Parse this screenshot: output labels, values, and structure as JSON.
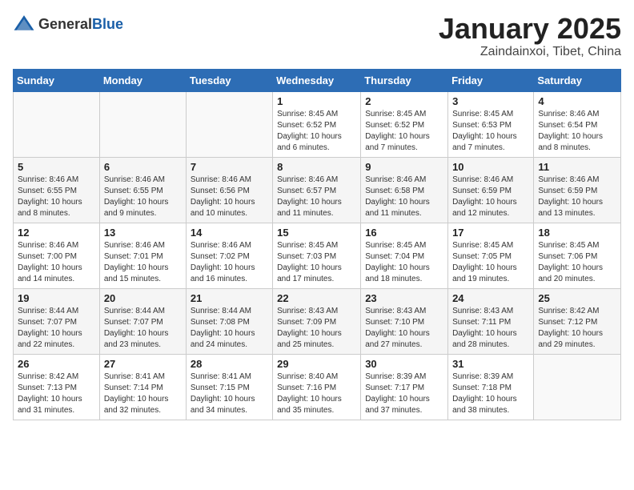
{
  "header": {
    "logo_general": "General",
    "logo_blue": "Blue",
    "month_title": "January 2025",
    "location": "Zaindainxoi, Tibet, China"
  },
  "weekdays": [
    "Sunday",
    "Monday",
    "Tuesday",
    "Wednesday",
    "Thursday",
    "Friday",
    "Saturday"
  ],
  "weeks": [
    [
      {
        "day": "",
        "info": ""
      },
      {
        "day": "",
        "info": ""
      },
      {
        "day": "",
        "info": ""
      },
      {
        "day": "1",
        "info": "Sunrise: 8:45 AM\nSunset: 6:52 PM\nDaylight: 10 hours\nand 6 minutes."
      },
      {
        "day": "2",
        "info": "Sunrise: 8:45 AM\nSunset: 6:52 PM\nDaylight: 10 hours\nand 7 minutes."
      },
      {
        "day": "3",
        "info": "Sunrise: 8:45 AM\nSunset: 6:53 PM\nDaylight: 10 hours\nand 7 minutes."
      },
      {
        "day": "4",
        "info": "Sunrise: 8:46 AM\nSunset: 6:54 PM\nDaylight: 10 hours\nand 8 minutes."
      }
    ],
    [
      {
        "day": "5",
        "info": "Sunrise: 8:46 AM\nSunset: 6:55 PM\nDaylight: 10 hours\nand 8 minutes."
      },
      {
        "day": "6",
        "info": "Sunrise: 8:46 AM\nSunset: 6:55 PM\nDaylight: 10 hours\nand 9 minutes."
      },
      {
        "day": "7",
        "info": "Sunrise: 8:46 AM\nSunset: 6:56 PM\nDaylight: 10 hours\nand 10 minutes."
      },
      {
        "day": "8",
        "info": "Sunrise: 8:46 AM\nSunset: 6:57 PM\nDaylight: 10 hours\nand 11 minutes."
      },
      {
        "day": "9",
        "info": "Sunrise: 8:46 AM\nSunset: 6:58 PM\nDaylight: 10 hours\nand 11 minutes."
      },
      {
        "day": "10",
        "info": "Sunrise: 8:46 AM\nSunset: 6:59 PM\nDaylight: 10 hours\nand 12 minutes."
      },
      {
        "day": "11",
        "info": "Sunrise: 8:46 AM\nSunset: 6:59 PM\nDaylight: 10 hours\nand 13 minutes."
      }
    ],
    [
      {
        "day": "12",
        "info": "Sunrise: 8:46 AM\nSunset: 7:00 PM\nDaylight: 10 hours\nand 14 minutes."
      },
      {
        "day": "13",
        "info": "Sunrise: 8:46 AM\nSunset: 7:01 PM\nDaylight: 10 hours\nand 15 minutes."
      },
      {
        "day": "14",
        "info": "Sunrise: 8:46 AM\nSunset: 7:02 PM\nDaylight: 10 hours\nand 16 minutes."
      },
      {
        "day": "15",
        "info": "Sunrise: 8:45 AM\nSunset: 7:03 PM\nDaylight: 10 hours\nand 17 minutes."
      },
      {
        "day": "16",
        "info": "Sunrise: 8:45 AM\nSunset: 7:04 PM\nDaylight: 10 hours\nand 18 minutes."
      },
      {
        "day": "17",
        "info": "Sunrise: 8:45 AM\nSunset: 7:05 PM\nDaylight: 10 hours\nand 19 minutes."
      },
      {
        "day": "18",
        "info": "Sunrise: 8:45 AM\nSunset: 7:06 PM\nDaylight: 10 hours\nand 20 minutes."
      }
    ],
    [
      {
        "day": "19",
        "info": "Sunrise: 8:44 AM\nSunset: 7:07 PM\nDaylight: 10 hours\nand 22 minutes."
      },
      {
        "day": "20",
        "info": "Sunrise: 8:44 AM\nSunset: 7:07 PM\nDaylight: 10 hours\nand 23 minutes."
      },
      {
        "day": "21",
        "info": "Sunrise: 8:44 AM\nSunset: 7:08 PM\nDaylight: 10 hours\nand 24 minutes."
      },
      {
        "day": "22",
        "info": "Sunrise: 8:43 AM\nSunset: 7:09 PM\nDaylight: 10 hours\nand 25 minutes."
      },
      {
        "day": "23",
        "info": "Sunrise: 8:43 AM\nSunset: 7:10 PM\nDaylight: 10 hours\nand 27 minutes."
      },
      {
        "day": "24",
        "info": "Sunrise: 8:43 AM\nSunset: 7:11 PM\nDaylight: 10 hours\nand 28 minutes."
      },
      {
        "day": "25",
        "info": "Sunrise: 8:42 AM\nSunset: 7:12 PM\nDaylight: 10 hours\nand 29 minutes."
      }
    ],
    [
      {
        "day": "26",
        "info": "Sunrise: 8:42 AM\nSunset: 7:13 PM\nDaylight: 10 hours\nand 31 minutes."
      },
      {
        "day": "27",
        "info": "Sunrise: 8:41 AM\nSunset: 7:14 PM\nDaylight: 10 hours\nand 32 minutes."
      },
      {
        "day": "28",
        "info": "Sunrise: 8:41 AM\nSunset: 7:15 PM\nDaylight: 10 hours\nand 34 minutes."
      },
      {
        "day": "29",
        "info": "Sunrise: 8:40 AM\nSunset: 7:16 PM\nDaylight: 10 hours\nand 35 minutes."
      },
      {
        "day": "30",
        "info": "Sunrise: 8:39 AM\nSunset: 7:17 PM\nDaylight: 10 hours\nand 37 minutes."
      },
      {
        "day": "31",
        "info": "Sunrise: 8:39 AM\nSunset: 7:18 PM\nDaylight: 10 hours\nand 38 minutes."
      },
      {
        "day": "",
        "info": ""
      }
    ]
  ]
}
